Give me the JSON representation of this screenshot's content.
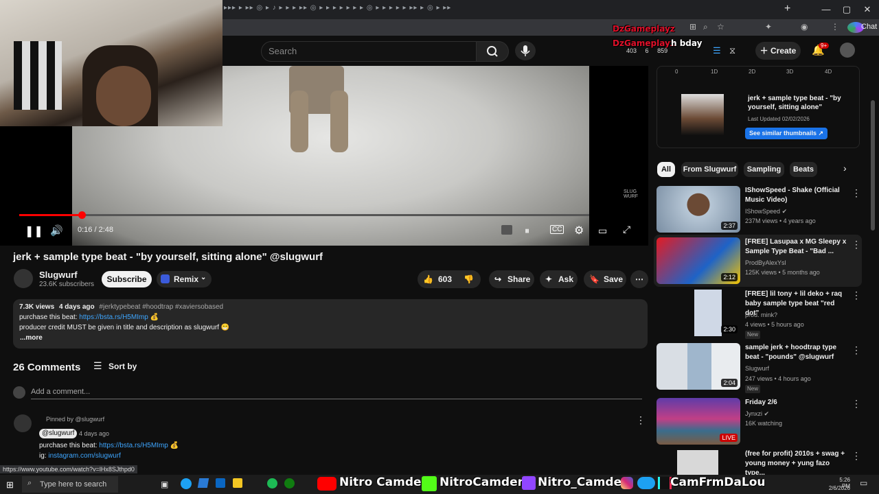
{
  "browser": {
    "tabs_strip_text": "▸▸▸ ▸ ▸▸ ◎ ▸ ♪ ▸ ▸ ▸ ▸▸ ◎ ▸ ▸ ▸ ▸ ▸ ▸ ▸ ◎ ▸ ▸ ▸ ▸ ▸ ▸▸ ▸ ◎ ▸ ▸▸",
    "window_controls": [
      "—",
      "▢",
      "✕"
    ],
    "chat_label": "Chat"
  },
  "youtube_header": {
    "search_placeholder": "Search",
    "create_label": "Create",
    "notification_count": "9+"
  },
  "stream_overlay": {
    "username": "DzGameplayz",
    "chat_msg_user": "DzGameplayz",
    "chat_msg_text": "h bday",
    "viewers": "403",
    "stat2": "6",
    "stat3": "859"
  },
  "player": {
    "time": "0:16 / 2:48",
    "watermark": "SLUG\nWURF",
    "progress_fraction": 0.11
  },
  "video": {
    "title": "jerk + sample type beat - \"by yourself, sitting alone\" @slugwurf",
    "channel_name": "Slugwurf",
    "subscribers": "23.6K subscribers",
    "subscribe_label": "Subscribe",
    "remix_label": "Remix",
    "likes": "603",
    "share_label": "Share",
    "ask_label": "Ask",
    "save_label": "Save"
  },
  "description": {
    "views": "7.3K views",
    "age": "4 days ago",
    "hashtags": "#jerktypebeat #hoodtrap #xaviersobased",
    "line1_text": "purchase this beat: ",
    "line1_link": "https://bsta.rs/H5MImp",
    "line1_emoji": "💰",
    "line2": "producer credit MUST be given in title and description as slugwurf 😁",
    "more": "...more"
  },
  "comments": {
    "count_label": "26 Comments",
    "sort_label": "Sort by",
    "add_placeholder": "Add a comment...",
    "pinned_label": "Pinned by @slugwurf",
    "first": {
      "handle": "@slugwurf",
      "age": "4 days ago",
      "line1_text": "purchase this beat: ",
      "line1_link": "https://bsta.rs/H5MImp",
      "line1_emoji": "💰",
      "line2_text": "ig: ",
      "line2_link": "instagram.com/slugwurf"
    }
  },
  "thumbnail_panel": {
    "axis_ticks": [
      "0",
      "1D",
      "2D",
      "3D",
      "4D"
    ],
    "title": "jerk + sample type beat - \"by yourself, sitting alone\"",
    "updated": "Last Updated 02/02/2026",
    "similar_button": "See similar thumbnails ↗"
  },
  "chips": [
    "All",
    "From Slugwurf",
    "Sampling",
    "Beats"
  ],
  "recommendations": [
    {
      "title": "IShowSpeed - Shake (Official Music Video)",
      "channel": "IShowSpeed",
      "verified": true,
      "meta": "237M views • 4 years ago",
      "duration": "2:37",
      "is_new": false,
      "live": false
    },
    {
      "title": "[FREE] Lasupaa x MG Sleepy x Sample Type Beat - \"Bad ...",
      "channel": "ProdByAlexYsl",
      "verified": false,
      "meta": "125K views • 5 months ago",
      "duration": "2:12",
      "is_new": false,
      "live": false
    },
    {
      "title": "[FREE] lil tony + lil deko + raq baby sample type beat \"red dot\"",
      "channel": "prod. mink?",
      "verified": false,
      "meta": "4 views • 5 hours ago",
      "duration": "2:30",
      "is_new": true,
      "live": false
    },
    {
      "title": "sample jerk + hoodtrap type beat - \"pounds\" @slugwurf",
      "channel": "Slugwurf",
      "verified": false,
      "meta": "247 views • 4 hours ago",
      "duration": "2:04",
      "is_new": true,
      "live": false
    },
    {
      "title": "Friday 2/6",
      "channel": "Jynxzi",
      "verified": true,
      "meta": "16K watching",
      "duration": "LIVE",
      "is_new": false,
      "live": true
    },
    {
      "title": "(free for profit) 2010s + swag + young money + yung fazo type...",
      "channel": "",
      "verified": false,
      "meta": "",
      "duration": "",
      "is_new": false,
      "live": false
    }
  ],
  "new_label": "New",
  "status_url": "https://www.youtube.com/watch?v=lHx8SJthpd0",
  "taskbar": {
    "search_placeholder": "Type here to search",
    "overlay_names": [
      "Nitro Camden",
      "NitroCamden",
      "Nitro_Camden",
      "CamFrmDaLou"
    ],
    "time": "5:26 PM",
    "date": "2/6/2026"
  },
  "colors": {
    "accent_red": "#ff0000",
    "link_blue": "#3ea6ff",
    "chip_active": "#f1f1f1",
    "overlay_red": "#e0102a"
  }
}
